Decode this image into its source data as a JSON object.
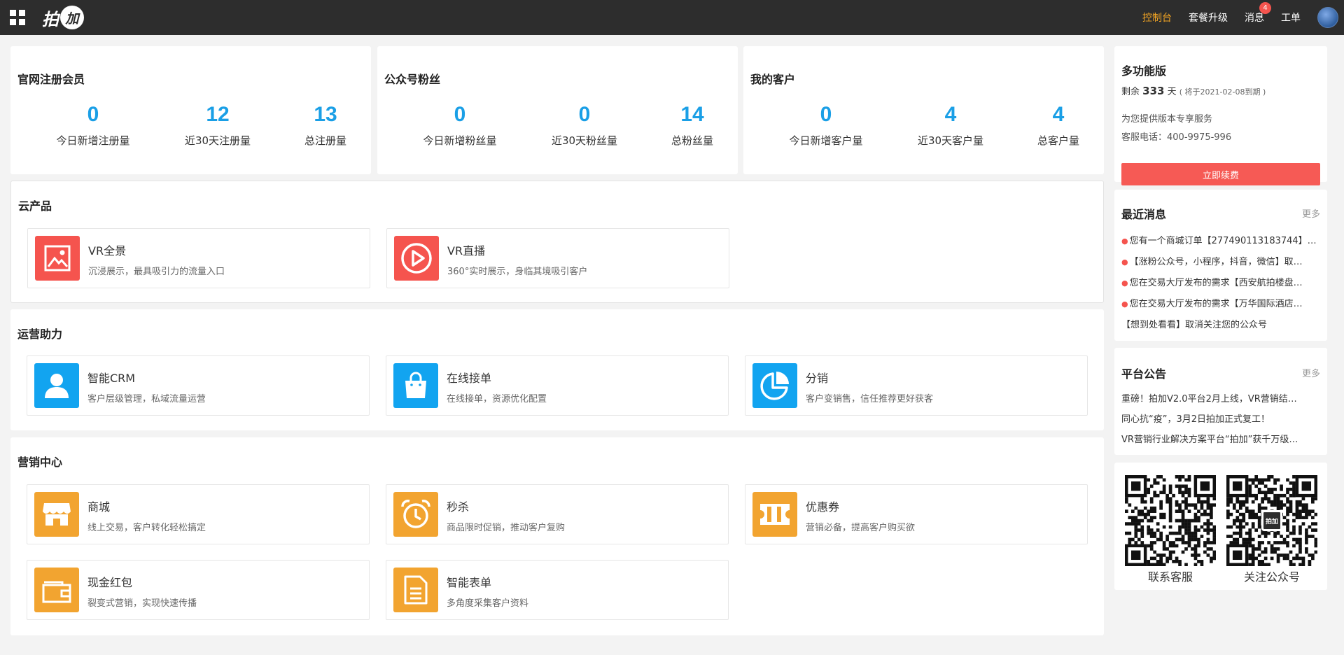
{
  "header": {
    "logo_text": "拍",
    "logo_mark": "加",
    "nav": [
      {
        "label": "控制台",
        "active": true
      },
      {
        "label": "套餐升级"
      },
      {
        "label": "消息",
        "badge": "4"
      },
      {
        "label": "工单"
      }
    ]
  },
  "stats": [
    {
      "title": "官网注册会员",
      "items": [
        {
          "value": "0",
          "label": "今日新增注册量"
        },
        {
          "value": "12",
          "label": "近30天注册量"
        },
        {
          "value": "13",
          "label": "总注册量"
        }
      ]
    },
    {
      "title": "公众号粉丝",
      "items": [
        {
          "value": "0",
          "label": "今日新增粉丝量"
        },
        {
          "value": "0",
          "label": "近30天粉丝量"
        },
        {
          "value": "14",
          "label": "总粉丝量"
        }
      ]
    },
    {
      "title": "我的客户",
      "items": [
        {
          "value": "0",
          "label": "今日新增客户量"
        },
        {
          "value": "4",
          "label": "近30天客户量"
        },
        {
          "value": "4",
          "label": "总客户量"
        }
      ]
    }
  ],
  "sections": {
    "cloud": {
      "title": "云产品",
      "features": [
        {
          "name": "VR全景",
          "desc": "沉浸展示，最具吸引力的流量入口",
          "icon": "image-icon"
        },
        {
          "name": "VR直播",
          "desc": "360°实时展示，身临其境吸引客户",
          "icon": "play-circle-icon"
        }
      ]
    },
    "operations": {
      "title": "运营助力",
      "features": [
        {
          "name": "智能CRM",
          "desc": "客户层级管理，私域流量运营",
          "icon": "user-icon"
        },
        {
          "name": "在线接单",
          "desc": "在线接单，资源优化配置",
          "icon": "shopping-bag-icon"
        },
        {
          "name": "分销",
          "desc": "客户变销售，信任推荐更好获客",
          "icon": "pie-chart-icon"
        }
      ]
    },
    "marketing": {
      "title": "营销中心",
      "features": [
        {
          "name": "商城",
          "desc": "线上交易，客户转化轻松搞定",
          "icon": "store-icon"
        },
        {
          "name": "秒杀",
          "desc": "商品限时促销，推动客户复购",
          "icon": "alarm-clock-icon"
        },
        {
          "name": "优惠券",
          "desc": "营销必备，提高客户购买欲",
          "icon": "coupon-icon"
        },
        {
          "name": "现金红包",
          "desc": "裂变式营销，实现快速传播",
          "icon": "wallet-icon"
        },
        {
          "name": "智能表单",
          "desc": "多角度采集客户资料",
          "icon": "document-icon"
        }
      ]
    }
  },
  "plan": {
    "title": "多功能版",
    "remaining_prefix": "剩余",
    "remaining_days": "333",
    "remaining_unit": "天",
    "expiry": "( 将于2021-02-08到期 )",
    "service_line": "为您提供版本专享服务",
    "phone": "客服电话：400-9975-996",
    "renew_label": "立即续费"
  },
  "messages": {
    "title": "最近消息",
    "more": "更多",
    "items": [
      {
        "text": "您有一个商城订单【277490113183744】…",
        "unread": true
      },
      {
        "text": "【涨粉公众号，小程序，抖音，微信】取…",
        "unread": true
      },
      {
        "text": "您在交易大厅发布的需求【西安航拍楼盘…",
        "unread": true
      },
      {
        "text": "您在交易大厅发布的需求【万华国际酒店…",
        "unread": true
      },
      {
        "text": "【想到处看看】取消关注您的公众号",
        "unread": false
      }
    ]
  },
  "notices": {
    "title": "平台公告",
    "more": "更多",
    "items": [
      "重磅！拍加V2.0平台2月上线，VR营销结…",
      "同心抗“疫”，3月2日拍加正式复工！",
      "VR营销行业解决方案平台“拍加”获千万级…"
    ]
  },
  "qrcodes": [
    {
      "label": "联系客服"
    },
    {
      "label": "关注公众号",
      "center_mark": "拍加"
    }
  ],
  "colors": {
    "accent_blue": "#1a9fe6",
    "red": "#f5544e",
    "blue": "#12a4f0",
    "orange": "#f2a430",
    "topbar": "#2d2d2d",
    "active_nav": "#f5a623"
  }
}
